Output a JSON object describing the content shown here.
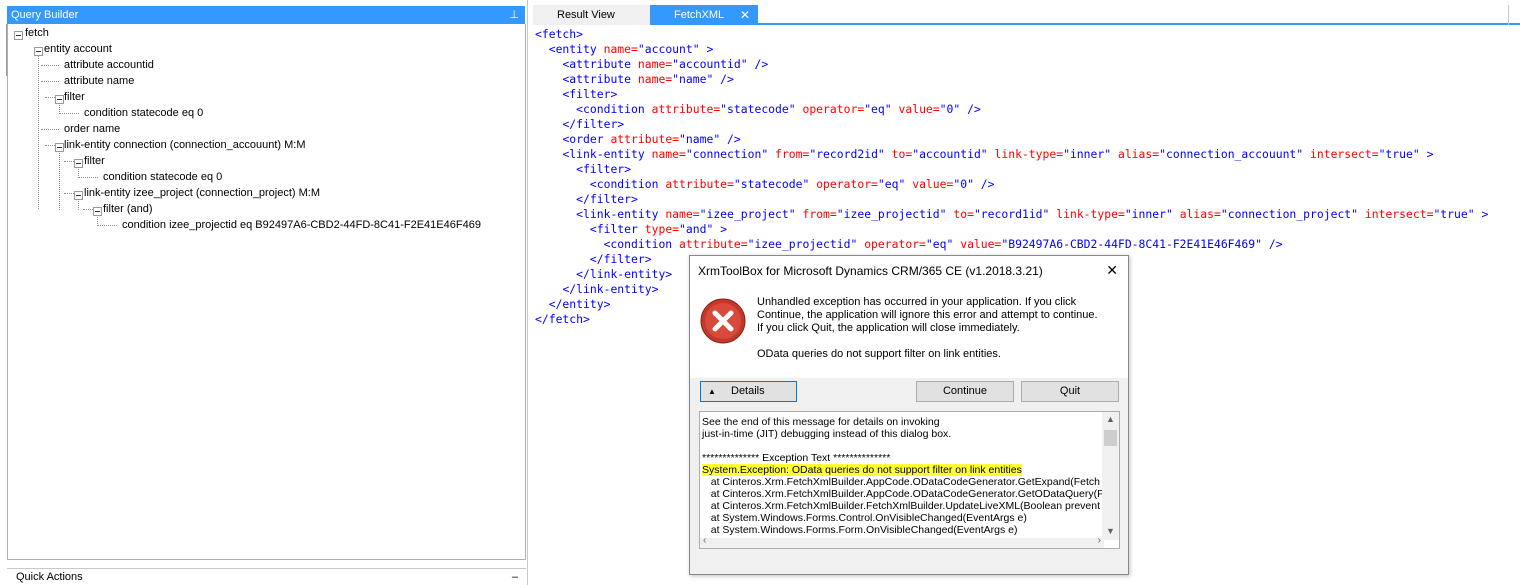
{
  "query_builder": {
    "title": "Query Builder",
    "pin_glyph": "⊥",
    "nodes": [
      "fetch",
      "entity account",
      "attribute accountid",
      "attribute name",
      "filter",
      "condition statecode eq 0",
      "order name",
      "link-entity connection (connection_accouunt) M:M",
      "filter",
      "condition statecode eq 0",
      "link-entity izee_project (connection_project) M:M",
      "filter (and)",
      "condition izee_projectid eq B92497A6-CBD2-44FD-8C41-F2E41E46F469"
    ]
  },
  "quick_actions": {
    "label": "Quick Actions",
    "minimize_glyph": "–"
  },
  "tabs": {
    "result_view": "Result View",
    "fetchxml": "FetchXML",
    "close_glyph": "✕"
  },
  "xml": {
    "l1": "<fetch>",
    "l2_a": "<entity",
    "l2_b": "name=",
    "l2_c": "\"account\"",
    "l2_d": " >",
    "l3_a": "<attribute",
    "l3_b": "name=",
    "l3_c": "\"accountid\"",
    "l3_d": " />",
    "l4_a": "<attribute",
    "l4_b": "name=",
    "l4_c": "\"name\"",
    "l4_d": " />",
    "l5": "<filter>",
    "l6_a": "<condition",
    "l6_b": "attribute=",
    "l6_c": "\"statecode\"",
    "l6_d": "operator=",
    "l6_e": "\"eq\"",
    "l6_f": "value=",
    "l6_g": "\"0\"",
    "l6_h": " />",
    "l7": "</filter>",
    "l8_a": "<order",
    "l8_b": "attribute=",
    "l8_c": "\"name\"",
    "l8_d": " />",
    "l9_a": "<link-entity",
    "l9_b": "name=",
    "l9_c": "\"connection\"",
    "l9_d": "from=",
    "l9_e": "\"record2id\"",
    "l9_f": "to=",
    "l9_g": "\"accountid\"",
    "l9_h": "link-type=",
    "l9_i": "\"inner\"",
    "l9_j": "alias=",
    "l9_k": "\"connection_accouunt\"",
    "l9_l": "intersect=",
    "l9_m": "\"true\"",
    "l9_n": " >",
    "l10": "<filter>",
    "l11_a": "<condition",
    "l11_b": "attribute=",
    "l11_c": "\"statecode\"",
    "l11_d": "operator=",
    "l11_e": "\"eq\"",
    "l11_f": "value=",
    "l11_g": "\"0\"",
    "l11_h": " />",
    "l12": "</filter>",
    "l13_a": "<link-entity",
    "l13_b": "name=",
    "l13_c": "\"izee_project\"",
    "l13_d": "from=",
    "l13_e": "\"izee_projectid\"",
    "l13_f": "to=",
    "l13_g": "\"record1id\"",
    "l13_h": "link-type=",
    "l13_i": "\"inner\"",
    "l13_j": "alias=",
    "l13_k": "\"connection_project\"",
    "l13_l": "intersect=",
    "l13_m": "\"true\"",
    "l13_n": " >",
    "l14_a": "<filter",
    "l14_b": "type=",
    "l14_c": "\"and\"",
    "l14_d": " >",
    "l15_a": "<condition",
    "l15_b": "attribute=",
    "l15_c": "\"izee_projectid\"",
    "l15_d": "operator=",
    "l15_e": "\"eq\"",
    "l15_f": "value=",
    "l15_g": "\"B92497A6-CBD2-44FD-8C41-F2E41E46F469\"",
    "l15_h": " />",
    "l16": "</filter>",
    "l17": "</link-entity>",
    "l18": "</link-entity>",
    "l19": "</entity>",
    "l20": "</fetch>"
  },
  "dialog": {
    "title": "XrmToolBox for Microsoft Dynamics CRM/365 CE (v1.2018.3.21)",
    "close_glyph": "✕",
    "message": "Unhandled exception has occurred in your application. If you click Continue, the application will ignore this error and attempt to continue. If you click Quit, the application will close immediately.",
    "error": "OData queries do not support filter on link entities.",
    "details_button": "Details",
    "details_arrow": "▲",
    "continue_button": "Continue",
    "quit_button": "Quit",
    "details": {
      "line1": "See the end of this message for details on invoking",
      "line2": "just-in-time (JIT) debugging instead of this dialog box.",
      "line3": "",
      "line4": "************** Exception Text **************",
      "line5": "System.Exception: OData queries do not support filter on link entities",
      "line6": "   at Cinteros.Xrm.FetchXmlBuilder.AppCode.ODataCodeGenerator.GetExpand(Fetch",
      "line7": "   at Cinteros.Xrm.FetchXmlBuilder.AppCode.ODataCodeGenerator.GetODataQuery(F",
      "line8": "   at Cinteros.Xrm.FetchXmlBuilder.FetchXmlBuilder.UpdateLiveXML(Boolean prevent",
      "line9": "   at System.Windows.Forms.Control.OnVisibleChanged(EventArgs e)",
      "line10": "   at System.Windows.Forms.Form.OnVisibleChanged(EventArgs e)"
    }
  }
}
